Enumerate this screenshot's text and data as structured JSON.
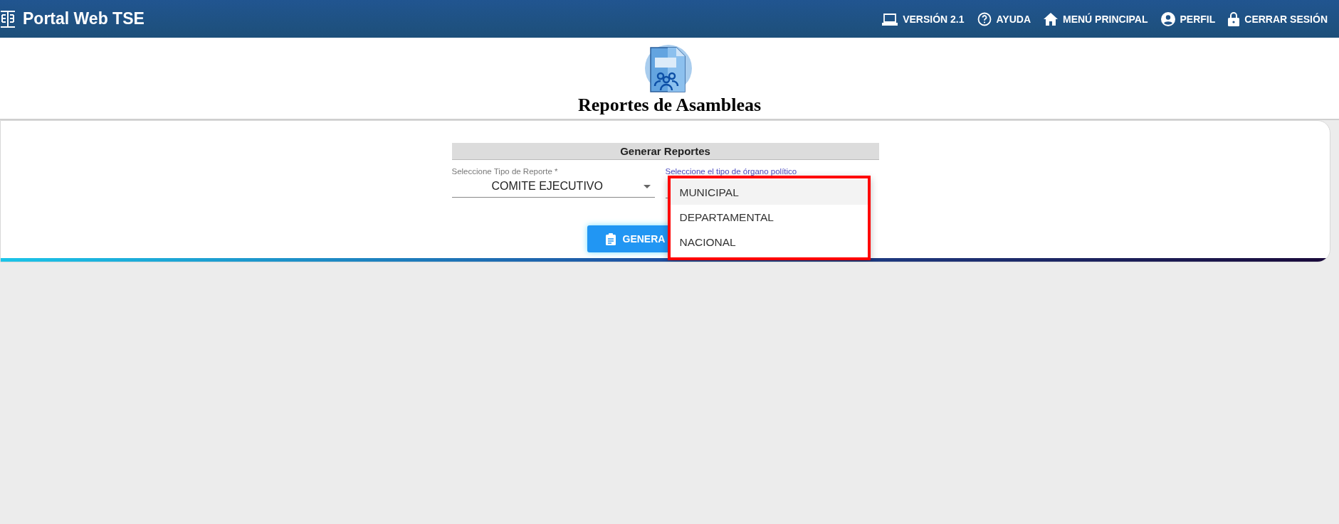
{
  "header": {
    "title": "Portal Web TSE",
    "nav": [
      {
        "kind": "laptop",
        "label": "VERSIÓN 2.1"
      },
      {
        "kind": "help",
        "label": "AYUDA"
      },
      {
        "kind": "home",
        "label": "MENÚ PRINCIPAL"
      },
      {
        "kind": "profile",
        "label": "PERFIL"
      },
      {
        "kind": "lock",
        "label": "CERRAR SESIÓN"
      }
    ]
  },
  "page_title": "Reportes de Asambleas",
  "form": {
    "section_title": "Generar Reportes",
    "report_type": {
      "label": "Seleccione Tipo de Reporte *",
      "value": "COMITE EJECUTIVO"
    },
    "organ_type": {
      "label": "Seleccione el tipo de órgano político",
      "expanded": true,
      "options": [
        {
          "label": "MUNICIPAL",
          "selected": true
        },
        {
          "label": "DEPARTAMENTAL",
          "selected": false
        },
        {
          "label": "NACIONAL",
          "selected": false
        }
      ]
    },
    "generate_button": "GENERA"
  }
}
